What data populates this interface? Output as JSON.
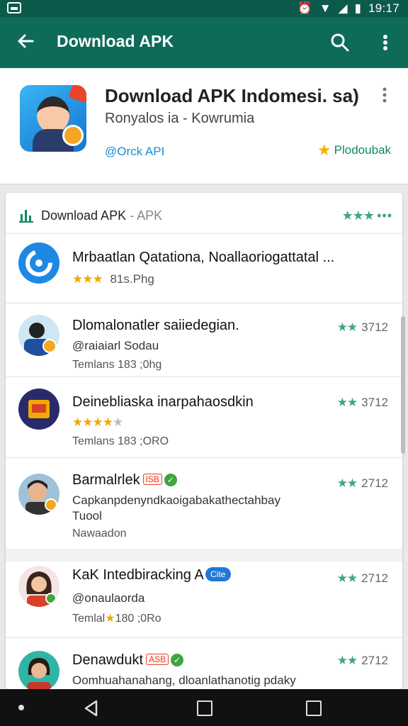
{
  "status_bar": {
    "time": "19:17"
  },
  "app_bar": {
    "title": "Download APK"
  },
  "app": {
    "title": "Download APK Indomesi. sa)",
    "developer": "Ronyalos ia - Kowrumia",
    "link": "@Orck API",
    "rating_label": "Plodoubak"
  },
  "list": {
    "title": "Download APK",
    "title_suffix": "- APK",
    "header_stars": "★★★",
    "header_dots": "•••",
    "rows": [
      {
        "title": "Mrbaatlan Qatationa, Noallaoriogattatal",
        "title_ellipsis": "...",
        "stars": "★★★",
        "meta": "81s.Phg"
      },
      {
        "title": "Dlomalonatler saiiedegian.",
        "line2": "@raiaiarl Sodau",
        "meta": "Temlans 183 ;0hg",
        "score_stars": "★★",
        "score": "3712"
      },
      {
        "title": "Deinebliaska inarpahaosdkin",
        "stars": "★★★★",
        "stars_dim": "★",
        "meta": "Temlans 183 ;ORO",
        "score_stars": "★★",
        "score": "3712"
      },
      {
        "title": "Barmalrlek",
        "tag": "ISB",
        "check": "✓",
        "line2": "Capkanpdenyndkaoigabakathectahbay",
        "line3": "Tuool",
        "meta": "Nawaadon",
        "score_stars": "★★",
        "score": "2712"
      },
      {
        "title": "KaK Intedbiracking A",
        "pill": "Cite",
        "line2": "@onaulaorda",
        "meta_a": "Temlal",
        "meta_star": "★",
        "meta_b": "180 ;0Ro",
        "score_stars": "★★",
        "score": "2712"
      },
      {
        "title": "Denawdukt",
        "tag": "ASB",
        "check": "✓",
        "line2": "Oomhuahanahang, dloanlathanotig pdaky",
        "score_stars": "★★",
        "score": "2712"
      }
    ]
  },
  "colors": {
    "app_bar": "#0e6b5a",
    "status_bar": "#0b5a4c",
    "accent_green": "#3fa67c",
    "star_gold": "#f2a900",
    "link_blue": "#1a8bd6"
  },
  "icons": [
    "back-arrow-icon",
    "search-icon",
    "more-vert-icon",
    "chart-icon",
    "star-icon",
    "check-icon",
    "nav-back-icon",
    "nav-home-icon",
    "nav-recent-icon"
  ]
}
